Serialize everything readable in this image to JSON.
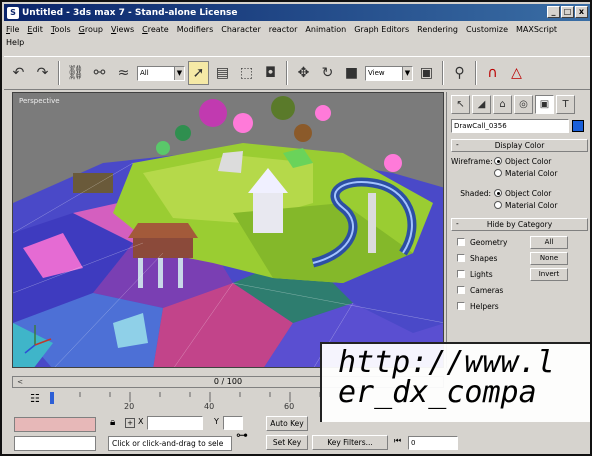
{
  "window": {
    "title": "Untitled - 3ds max 7 - Stand-alone License",
    "minimize": "_",
    "maximize": "□",
    "close": "x"
  },
  "menu": [
    {
      "u": "F",
      "rest": "ile"
    },
    {
      "u": "E",
      "rest": "dit"
    },
    {
      "u": "T",
      "rest": "ools"
    },
    {
      "u": "G",
      "rest": "roup"
    },
    {
      "u": "V",
      "rest": "iews"
    },
    {
      "u": "C",
      "rest": "reate"
    },
    {
      "u": "",
      "rest": "Modifiers"
    },
    {
      "u": "",
      "rest": "Character"
    },
    {
      "u": "",
      "rest": "reactor"
    },
    {
      "u": "",
      "rest": "Animation"
    },
    {
      "u": "",
      "rest": "Graph Editors"
    },
    {
      "u": "",
      "rest": "Rendering"
    },
    {
      "u": "",
      "rest": "Customize"
    },
    {
      "u": "",
      "rest": "MAXScript"
    },
    {
      "u": "",
      "rest": "Help"
    }
  ],
  "toolbar": {
    "selection_filter": "All",
    "reference_coord": "View"
  },
  "viewport": {
    "label": "Perspective"
  },
  "command_panel": {
    "object_name": "DrawCall_0356",
    "display_color": {
      "title": "Display Color",
      "wireframe_label": "Wireframe:",
      "shaded_label": "Shaded:",
      "object_color": "Object Color",
      "material_color": "Material Color"
    },
    "hide_by_category": {
      "title": "Hide by Category",
      "items": [
        "Geometry",
        "Shapes",
        "Lights",
        "Cameras",
        "Helpers"
      ],
      "buttons": [
        "All",
        "None",
        "Invert"
      ]
    }
  },
  "time_slider": {
    "value": "0 / 100"
  },
  "trackbar": {
    "ticks": [
      "20",
      "40",
      "60"
    ]
  },
  "status": {
    "x_label": "X",
    "y_label": "Y",
    "prompt": "Click or click-and-drag to sele",
    "auto_key": "Auto Key",
    "set_key": "Set Key",
    "key_filters": "Key Filters...",
    "frame_value": "0"
  },
  "watermark": {
    "line1": "http://www.l",
    "line2": "er_dx_compa"
  }
}
